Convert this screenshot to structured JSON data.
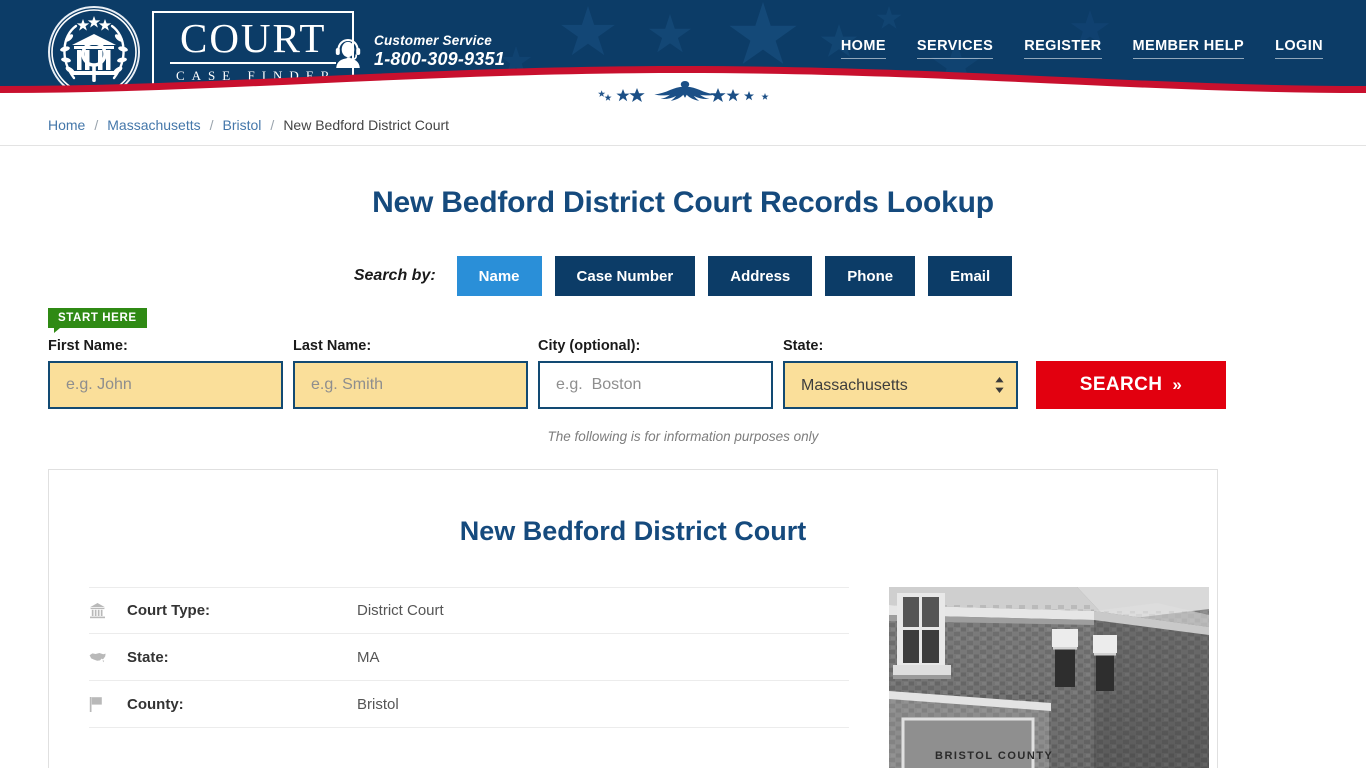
{
  "header": {
    "logo": {
      "word_top": "COURT",
      "word_bottom": "CASE FINDER",
      "seal_icon": "court-seal-icon"
    },
    "customer_service": {
      "icon": "headset-agent-icon",
      "label": "Customer Service",
      "phone": "1-800-309-9351"
    },
    "nav": [
      {
        "label": "HOME"
      },
      {
        "label": "SERVICES"
      },
      {
        "label": "REGISTER"
      },
      {
        "label": "MEMBER HELP"
      },
      {
        "label": "LOGIN"
      }
    ],
    "colors": {
      "navy": "#0c3c67",
      "red": "#c8102e",
      "white": "#ffffff"
    }
  },
  "breadcrumb": {
    "items": [
      {
        "label": "Home",
        "current": false
      },
      {
        "label": "Massachusetts",
        "current": false
      },
      {
        "label": "Bristol",
        "current": false
      },
      {
        "label": "New Bedford District Court",
        "current": true
      }
    ],
    "separator": "/"
  },
  "page": {
    "title": "New Bedford District Court Records Lookup",
    "disclaimer": "The following is for information purposes only"
  },
  "search": {
    "search_by_label": "Search by:",
    "tabs": [
      {
        "label": "Name",
        "active": true
      },
      {
        "label": "Case Number",
        "active": false
      },
      {
        "label": "Address",
        "active": false
      },
      {
        "label": "Phone",
        "active": false
      },
      {
        "label": "Email",
        "active": false
      }
    ],
    "start_badge": "START HERE",
    "fields": {
      "first_name": {
        "label": "First Name:",
        "placeholder": "e.g. John",
        "value": ""
      },
      "last_name": {
        "label": "Last Name:",
        "placeholder": "e.g. Smith",
        "value": ""
      },
      "city": {
        "label": "City (optional):",
        "placeholder": "e.g.  Boston",
        "value": ""
      },
      "state": {
        "label": "State:",
        "value": "Massachusetts",
        "options": [
          "Massachusetts"
        ]
      }
    },
    "submit_label": "SEARCH",
    "submit_chevron": "»",
    "accent_colors": {
      "active_tab": "#2a8fd8",
      "tab": "#0c3c67",
      "search_button": "#e2000f",
      "field_highlight": "#fadf9a",
      "badge_green": "#2f8a14"
    }
  },
  "court_card": {
    "title": "New Bedford District Court",
    "rows": [
      {
        "icon": "courthouse-icon",
        "label": "Court Type:",
        "value": "District Court"
      },
      {
        "icon": "us-map-icon",
        "label": "State:",
        "value": "MA"
      },
      {
        "icon": "flag-icon",
        "label": "County:",
        "value": "Bristol"
      }
    ],
    "photo": {
      "name": "courthouse-photo",
      "sign_text": "BRISTOL  COUNTY"
    }
  }
}
